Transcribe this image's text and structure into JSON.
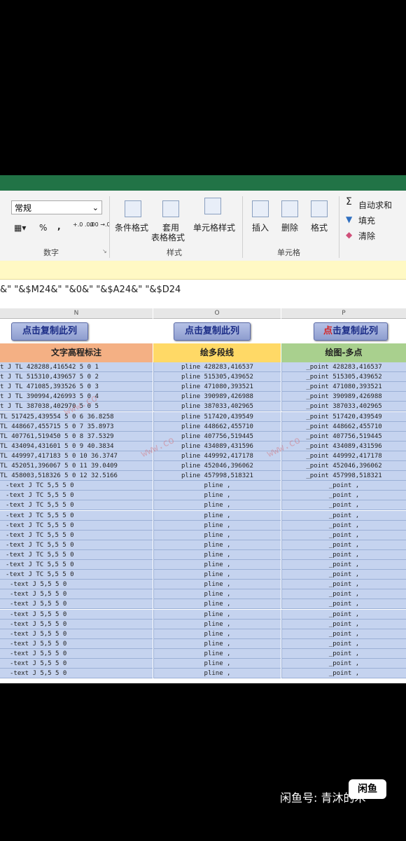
{
  "ribbon": {
    "number_format": "常规",
    "number_group": "数字",
    "percent": "%",
    "comma": ",",
    "dec_inc": "+.0 .00",
    "dec_dec": ".00 →.0",
    "conditional_format": "条件格式",
    "table_format_top": "套用",
    "table_format": "表格格式",
    "cell_style": "单元格样式",
    "style_group": "样式",
    "insert": "插入",
    "delete": "删除",
    "format": "格式",
    "cells_group": "单元格",
    "autosum": "自动求和",
    "fill": "填充",
    "clear": "清除"
  },
  "formula_text": "&\" \"&$M24&\" \"&0&\" \"&$A24&\" \"&$D24",
  "columns": {
    "n": "N",
    "o": "O",
    "p": "P"
  },
  "buttons": {
    "n": "点击复制此列",
    "o": "点击复制此列",
    "p_red": "点",
    "p_rest": "击复制此列"
  },
  "headers": {
    "n": "文字高程标注",
    "o": "绘多段线",
    "p": "绘图-多点"
  },
  "colors": {
    "header_n": "#f4b084",
    "header_o": "#ffd966",
    "header_p": "#a9d08e",
    "cell_bg": "#c5d3ef",
    "ribbon_green": "#217346"
  },
  "rows": [
    {
      "n": "t J TL 428288,416542 5 0 1",
      "o": "pline 428283,416537",
      "p": "_point 428283,416537"
    },
    {
      "n": "t J TL 515310,439657 5 0 2",
      "o": "pline 515305,439652",
      "p": "_point 515305,439652"
    },
    {
      "n": "t J TL 471085,393526 5 0 3",
      "o": "pline 471080,393521",
      "p": "_point 471080,393521"
    },
    {
      "n": "t J TL 390994,426993 5 0 4",
      "o": "pline 390989,426988",
      "p": "_point 390989,426988"
    },
    {
      "n": "t J TL 387038,402970 5 0 5",
      "o": "pline 387033,402965",
      "p": "_point 387033,402965"
    },
    {
      "n": "TL 517425,439554 5 0 6 36.8258",
      "o": "pline 517420,439549",
      "p": "_point 517420,439549"
    },
    {
      "n": "TL 448667,455715 5 0 7 35.8973",
      "o": "pline 448662,455710",
      "p": "_point 448662,455710"
    },
    {
      "n": "TL 407761,519450 5 0 8 37.5329",
      "o": "pline 407756,519445",
      "p": "_point 407756,519445"
    },
    {
      "n": "TL 434094,431601 5 0 9 40.3834",
      "o": "pline 434089,431596",
      "p": "_point 434089,431596"
    },
    {
      "n": "TL 449997,417183 5 0 10 36.3747",
      "o": "pline 449992,417178",
      "p": "_point 449992,417178"
    },
    {
      "n": "TL 452051,396067 5 0 11 39.0409",
      "o": "pline 452046,396062",
      "p": "_point 452046,396062"
    },
    {
      "n": "TL 458003,518326 5 0 12 32.5166",
      "o": "pline 457998,518321",
      "p": "_point 457998,518321"
    },
    {
      "n": "-text J TC 5,5 5 0",
      "o": "pline ,",
      "p": "_point ,"
    },
    {
      "n": "-text J TC 5,5 5 0",
      "o": "pline ,",
      "p": "_point ,"
    },
    {
      "n": "-text J TC 5,5 5 0",
      "o": "pline ,",
      "p": "_point ,"
    },
    {
      "n": "-text J TC 5,5 5 0",
      "o": "pline ,",
      "p": "_point ,"
    },
    {
      "n": "-text J TC 5,5 5 0",
      "o": "pline ,",
      "p": "_point ,"
    },
    {
      "n": "-text J TC 5,5 5 0",
      "o": "pline ,",
      "p": "_point ,"
    },
    {
      "n": "-text J TC 5,5 5 0",
      "o": "pline ,",
      "p": "_point ,"
    },
    {
      "n": "-text J TC 5,5 5 0",
      "o": "pline ,",
      "p": "_point ,"
    },
    {
      "n": "-text J TC 5,5 5 0",
      "o": "pline ,",
      "p": "_point ,"
    },
    {
      "n": "-text J TC 5,5 5 0",
      "o": "pline ,",
      "p": "_point ,"
    },
    {
      "n": "-text J 5,5 5 0",
      "o": "pline ,",
      "p": "_point ,"
    },
    {
      "n": "-text J 5,5 5 0",
      "o": "pline ,",
      "p": "_point ,"
    },
    {
      "n": "-text J 5,5 5 0",
      "o": "pline ,",
      "p": "_point ,"
    },
    {
      "n": "-text J 5,5 5 0",
      "o": "pline ,",
      "p": "_point ,"
    },
    {
      "n": "-text J 5,5 5 0",
      "o": "pline ,",
      "p": "_point ,"
    },
    {
      "n": "-text J 5,5 5 0",
      "o": "pline ,",
      "p": "_point ,"
    },
    {
      "n": "-text J 5,5 5 0",
      "o": "pline ,",
      "p": "_point ,"
    },
    {
      "n": "-text J 5,5 5 0",
      "o": "pline ,",
      "p": "_point ,"
    },
    {
      "n": "-text J 5,5 5 0",
      "o": "pline ,",
      "p": "_point ,"
    },
    {
      "n": "-text J 5,5 5 0",
      "o": "pline ,",
      "p": "_point ,"
    }
  ],
  "watermark": "www.co",
  "footer": {
    "badge": "闲鱼",
    "text": "闲鱼号: 青沐的木"
  }
}
